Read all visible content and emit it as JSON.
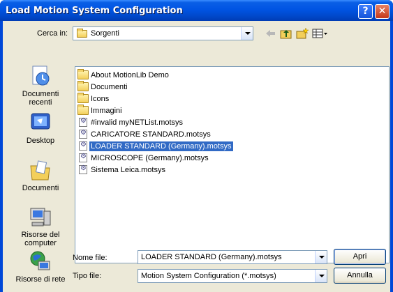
{
  "window": {
    "title": "Load Motion System Configuration",
    "help_label": "?",
    "close_label": "✕"
  },
  "toolbar": {
    "look_in_label": "Cerca in:",
    "look_in_value": "Sorgenti",
    "icons": [
      "back-arrow-icon",
      "up-folder-icon",
      "new-folder-icon",
      "view-menu-icon"
    ]
  },
  "places": [
    {
      "label": "Documenti recenti",
      "icon": "recent-documents-icon"
    },
    {
      "label": "Desktop",
      "icon": "desktop-icon"
    },
    {
      "label": "Documenti",
      "icon": "my-documents-icon"
    },
    {
      "label": "Risorse del computer",
      "icon": "my-computer-icon"
    },
    {
      "label": "Risorse di rete",
      "icon": "network-places-icon"
    }
  ],
  "files": [
    {
      "name": "About MotionLib Demo",
      "type": "folder"
    },
    {
      "name": "Documenti",
      "type": "folder"
    },
    {
      "name": "Icons",
      "type": "folder"
    },
    {
      "name": "Immagini",
      "type": "folder"
    },
    {
      "name": "#invalid myNETList.motsys",
      "type": "file"
    },
    {
      "name": "CARICATORE STANDARD.motsys",
      "type": "file"
    },
    {
      "name": "LOADER STANDARD (Germany).motsys",
      "type": "file",
      "selected": true
    },
    {
      "name": "MICROSCOPE (Germany).motsys",
      "type": "file"
    },
    {
      "name": "Sistema Leica.motsys",
      "type": "file"
    }
  ],
  "bottom": {
    "filename_label": "Nome file:",
    "filename_value": "LOADER STANDARD (Germany).motsys",
    "filetype_label": "Tipo file:",
    "filetype_value": "Motion System Configuration (*.motsys)",
    "open_button": "Apri",
    "cancel_button": "Annulla"
  }
}
